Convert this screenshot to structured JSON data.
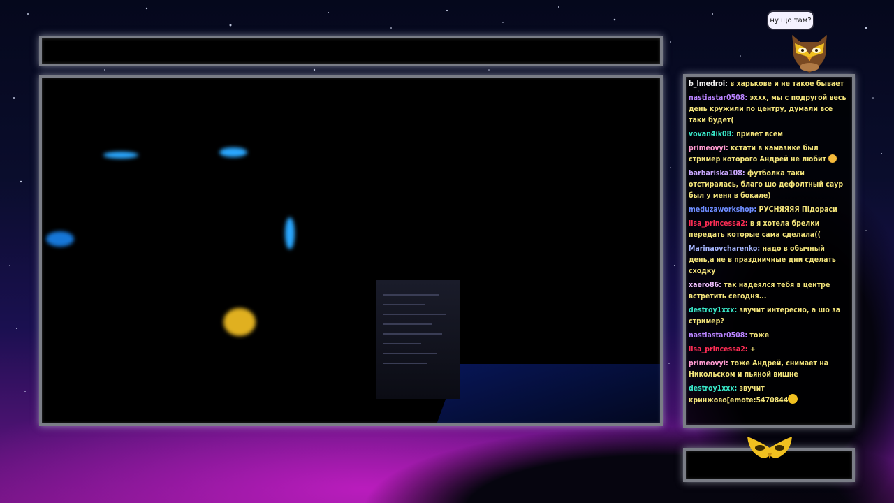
{
  "bubble": {
    "text": "ну що там?"
  },
  "chat": {
    "messages": [
      {
        "user": "b_lmedroi:",
        "color": "#f2f2f2",
        "text": "в харькове и не такое бывает"
      },
      {
        "user": "nastiastar0508:",
        "color": "#b983ff",
        "text": "эххх, мы с подругой весь день кружили по центру, думали все таки будет("
      },
      {
        "user": "vovan4ik08:",
        "color": "#39e6c8",
        "text": "привет всем"
      },
      {
        "user": "primeovyi:",
        "color": "#ff9ad0",
        "text": "кстати в камазике был стример которого Андрей не любит"
      },
      {
        "user": "barbariska108:",
        "color": "#c9a7ff",
        "text": "футболка таки отстиралась, благо шо дефолтный саур был у меня в бокале)"
      },
      {
        "user": "meduzaworkshop:",
        "color": "#6d8cff",
        "text": "РУСНЯЯЯЯ ПІдораси"
      },
      {
        "user": "lisa_princessa2:",
        "color": "#ff2d55",
        "text": "в я хотела брелки передать которые сама сделала(("
      },
      {
        "user": "Marinaovcharenko:",
        "color": "#a6b6ff",
        "text": "надо в обычный день,а не в праздничные дни сделать сходку"
      },
      {
        "user": "xaero86:",
        "color": "#f0c0ff",
        "text": "так надеялся тебя в центре встретить сегодня..."
      },
      {
        "user": "destroy1xxx:",
        "color": "#39e6c8",
        "text": "звучит интересно, а шо за стример?"
      },
      {
        "user": "nastiastar0508:",
        "color": "#b983ff",
        "text": "тоже"
      },
      {
        "user": "lisa_princessa2:",
        "color": "#ff2d55",
        "text": "+"
      },
      {
        "user": "primeovyi:",
        "color": "#ff9ad0",
        "text": "тоже Андрей, снимает на Никольском и пьяной вишне"
      },
      {
        "user": "destroy1xxx:",
        "color": "#39e6c8",
        "text": "звучит кринжово[emote:5470844"
      }
    ]
  },
  "colors": {
    "message_text": "#f2e37a",
    "frame_border": "#7a7d86",
    "owl_gold": "#f0c020"
  },
  "icons": {
    "bubble_owl": "owl-icon",
    "logo": "owl-mask-logo-icon",
    "emote_smile": "smile-emote-icon",
    "emote_owl": "owl-emote-icon"
  }
}
